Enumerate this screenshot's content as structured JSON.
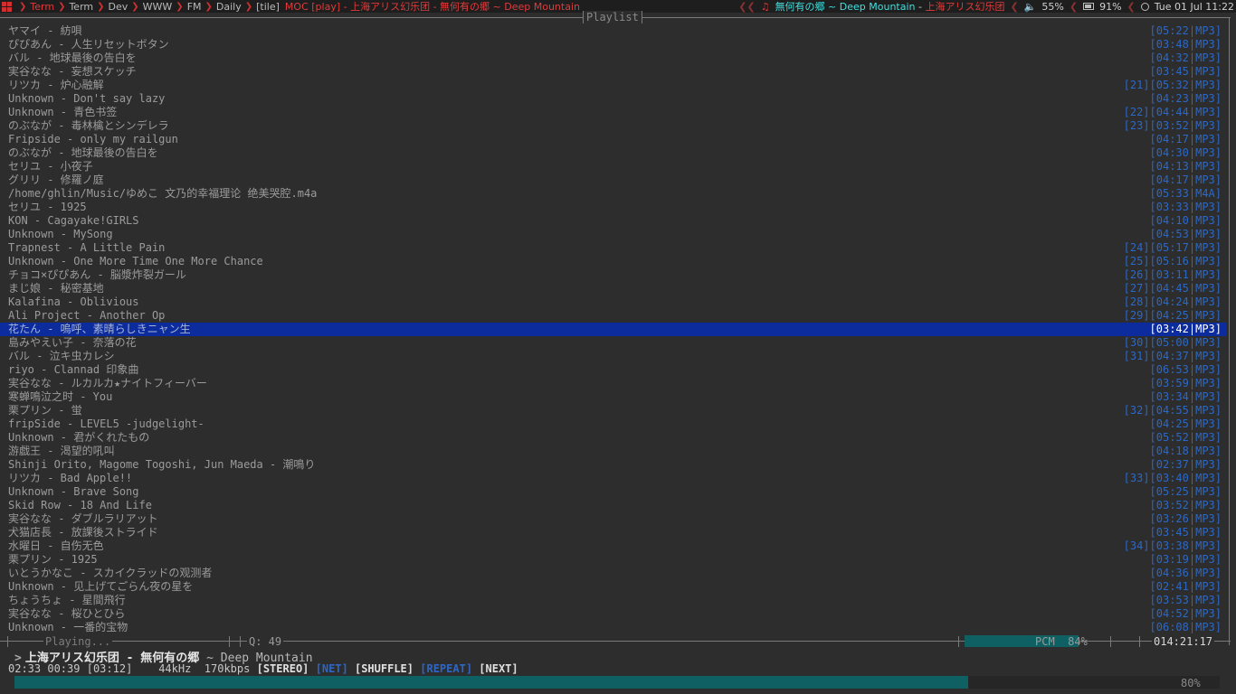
{
  "topbar": {
    "workspaces": [
      {
        "label": "Term",
        "active": true
      },
      {
        "label": "Term",
        "active": false
      },
      {
        "label": "Dev",
        "active": false
      },
      {
        "label": "WWW",
        "active": false
      },
      {
        "label": "FM",
        "active": false
      },
      {
        "label": "Daily",
        "active": false
      }
    ],
    "layout": "[tile]",
    "window_title": "MOC [play] - 上海アリス幻乐团 - 無何有の郷 ~ Deep Mountain",
    "now_playing_title": "無何有の郷 ~ Deep Mountain",
    "now_playing_sep": " - ",
    "now_playing_artist": "上海アリス幻乐团",
    "volume": "55%",
    "battery": "91%",
    "clock": "Tue 01 Jul 11:22",
    "icons": {
      "layout": "grid-icon",
      "music": "music-note-icon",
      "volume": "speaker-icon",
      "battery": "battery-icon",
      "clock": "clock-icon"
    }
  },
  "playlist": {
    "title": "Playlist",
    "rows": [
      {
        "title": "ヤマイ - 紡唄",
        "meta": "[05:22|MP3]"
      },
      {
        "title": "ぴぴあん - 人生リセットボタン",
        "meta": "[03:48|MP3]"
      },
      {
        "title": "バル - 地球最後の告白を",
        "meta": "[04:32|MP3]"
      },
      {
        "title": "実谷なな - 妄想スケッチ",
        "meta": "[03:45|MP3]"
      },
      {
        "title": "リツカ - 炉心融解",
        "meta": "[21][05:32|MP3]"
      },
      {
        "title": "Unknown - Don't say lazy",
        "meta": "[04:23|MP3]"
      },
      {
        "title": "Unknown - 青色书签",
        "meta": "[22][04:44|MP3]"
      },
      {
        "title": "のぶなが - 毒林檎とシンデレラ",
        "meta": "[23][03:52|MP3]"
      },
      {
        "title": "Fripside - only my railgun",
        "meta": "[04:17|MP3]"
      },
      {
        "title": "のぶなが - 地球最後の告白を",
        "meta": "[04:30|MP3]"
      },
      {
        "title": "セリユ - 小夜子",
        "meta": "[04:13|MP3]"
      },
      {
        "title": "グリリ - 修羅ノ庭",
        "meta": "[04:17|MP3]"
      },
      {
        "title": "/home/ghlin/Music/ゆめこ 文乃的幸福理论 绝美哭腔.m4a",
        "meta": "[05:33|M4A]"
      },
      {
        "title": "セリユ - 1925",
        "meta": "[03:33|MP3]"
      },
      {
        "title": "KON - Cagayake!GIRLS",
        "meta": "[04:10|MP3]"
      },
      {
        "title": "Unknown - MySong",
        "meta": "[04:53|MP3]"
      },
      {
        "title": "Trapnest - A Little Pain",
        "meta": "[24][05:17|MP3]"
      },
      {
        "title": "Unknown - One More Time One More Chance",
        "meta": "[25][05:16|MP3]"
      },
      {
        "title": "チョコ×ぴぴあん - 脳漿炸裂ガール",
        "meta": "[26][03:11|MP3]"
      },
      {
        "title": "まじ娘 - 秘密基地",
        "meta": "[27][04:45|MP3]"
      },
      {
        "title": "Kalafina - Oblivious",
        "meta": "[28][04:24|MP3]"
      },
      {
        "title": "Ali Project - Another Op",
        "meta": "[29][04:25|MP3]"
      },
      {
        "title": "花たん - 嗚呼、素晴らしきニャン生",
        "meta": "[03:42|MP3]",
        "selected": true
      },
      {
        "title": "島みやえい子 - 奈落の花",
        "meta": "[30][05:00|MP3]"
      },
      {
        "title": "バル - 泣キ虫カレシ",
        "meta": "[31][04:37|MP3]"
      },
      {
        "title": "riyo - Clannad 印象曲",
        "meta": "[06:53|MP3]"
      },
      {
        "title": "実谷なな - ルカルカ★ナイトフィーバー",
        "meta": "[03:59|MP3]"
      },
      {
        "title": "寒蝉鳴泣之时 - You",
        "meta": "[03:34|MP3]"
      },
      {
        "title": "栗プリン - 蛍",
        "meta": "[32][04:55|MP3]"
      },
      {
        "title": "fripSide - LEVEL5 -judgelight-",
        "meta": "[04:25|MP3]"
      },
      {
        "title": "Unknown - 君がくれたもの",
        "meta": "[05:52|MP3]"
      },
      {
        "title": "游戯王 - 渴望的吼叫",
        "meta": "[04:18|MP3]"
      },
      {
        "title": "Shinji Orito, Magome Togoshi, Jun Maeda - 潮鳴り",
        "meta": "[02:37|MP3]"
      },
      {
        "title": "リツカ - Bad Apple!!",
        "meta": "[33][03:40|MP3]"
      },
      {
        "title": "Unknown - Brave Song",
        "meta": "[05:25|MP3]"
      },
      {
        "title": "Skid Row - 18 And Life",
        "meta": "[03:52|MP3]"
      },
      {
        "title": "実谷なな - ダブルラリアット",
        "meta": "[03:26|MP3]"
      },
      {
        "title": "犬猫店長 - 放課後ストライド",
        "meta": "[03:45|MP3]"
      },
      {
        "title": "水曜日 - 自伤无色",
        "meta": "[34][03:38|MP3]"
      },
      {
        "title": "栗プリン - 1925",
        "meta": "[03:19|MP3]"
      },
      {
        "title": "いとうかなこ - スカイクラッドの观测者",
        "meta": "[04:36|MP3]"
      },
      {
        "title": "Unknown - 见上げてごらん夜の星を",
        "meta": "[02:41|MP3]"
      },
      {
        "title": "ちょうちょ - 星間飛行",
        "meta": "[03:53|MP3]"
      },
      {
        "title": "実谷なな - 桜ひとひら",
        "meta": "[04:52|MP3]"
      },
      {
        "title": "Unknown - 一番的宝物",
        "meta": "[06:08|MP3]"
      }
    ]
  },
  "bottom": {
    "playing_label": "Playing...",
    "queue_label": "Q: 49",
    "mixer_label": "PCM",
    "mixer_value": "84%",
    "mixer_level": 0.84,
    "total_time": "014:21:17",
    "now_arrow": ">",
    "now_song": "上海アリス幻乐团 - 無何有の郷",
    "now_sub": "~ Deep Mountain",
    "status": {
      "time_pos": "02:33",
      "time_left": "00:39",
      "duration": "[03:12]",
      "rate": "44kHz",
      "bitrate": "170kbps",
      "stereo": "[STEREO]",
      "net": "[NET]",
      "shuffle": "[SHUFFLE]",
      "repeat": "[REPEAT]",
      "next": "[NEXT]"
    },
    "progress_label": "80%",
    "progress_level": 0.8
  },
  "colors": {
    "background": "#2d2d2d",
    "playlist_meta": "#2c68c6",
    "selected_row": "#0c2c9e",
    "accent_red": "#e03a3a",
    "accent_cyan": "#3fe0e0",
    "bar_teal": "#0f6062"
  }
}
